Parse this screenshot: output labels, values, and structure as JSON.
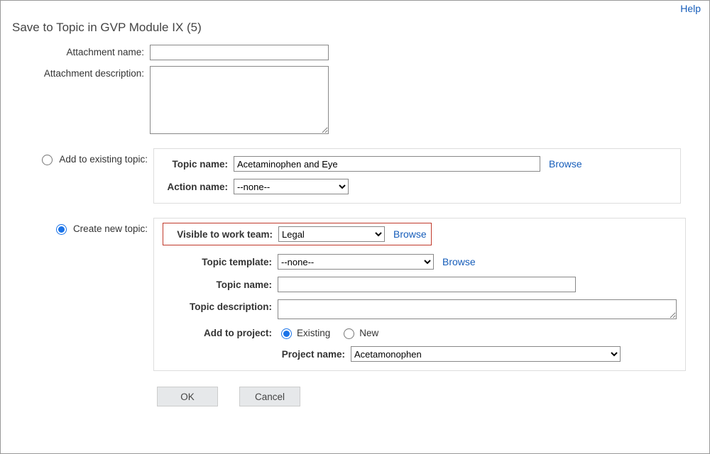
{
  "help_label": "Help",
  "title": "Save to Topic in GVP Module IX (5)",
  "attachment": {
    "name_label": "Attachment name:",
    "name_value": "",
    "desc_label": "Attachment description:",
    "desc_value": ""
  },
  "existing": {
    "radio_label": "Add to existing topic:",
    "topic_name_label": "Topic name:",
    "topic_name_value": "Acetaminophen and Eye",
    "browse": "Browse",
    "action_name_label": "Action name:",
    "action_name_value": "--none--"
  },
  "create": {
    "radio_label": "Create new topic:",
    "visible_label": "Visible to work team:",
    "visible_value": "Legal",
    "browse": "Browse",
    "template_label": "Topic template:",
    "template_value": "--none--",
    "topic_name_label": "Topic name:",
    "topic_name_value": "",
    "topic_desc_label": "Topic description:",
    "topic_desc_value": "",
    "add_to_project_label": "Add to project:",
    "project_existing": "Existing",
    "project_new": "New",
    "project_name_label": "Project name:",
    "project_name_value": "Acetamonophen"
  },
  "buttons": {
    "ok": "OK",
    "cancel": "Cancel"
  }
}
